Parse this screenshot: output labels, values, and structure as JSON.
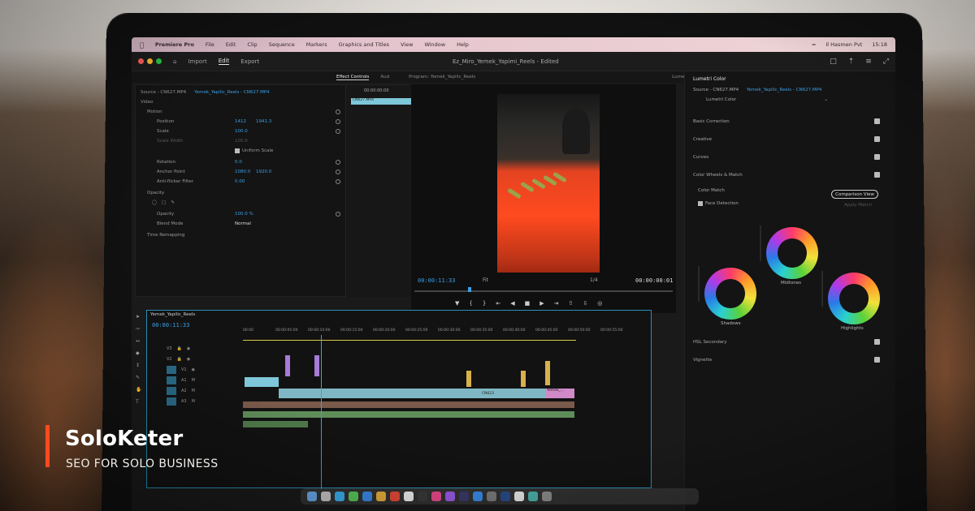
{
  "brand": {
    "name": "SoloKeter",
    "tagline": "SEO FOR SOLO BUSINESS",
    "accent_color": "#ff4a1f"
  },
  "menubar": {
    "app": "Premiere Pro",
    "items": [
      "File",
      "Edit",
      "Clip",
      "Sequence",
      "Markers",
      "Graphics and Titles",
      "View",
      "Window",
      "Help"
    ],
    "right_user": "Il Hasmen Pvt",
    "right_time": "15:18"
  },
  "app_header": {
    "tabs": [
      "Import",
      "Edit",
      "Export"
    ],
    "active_tab": "Edit",
    "document_title": "Ez_Miro_Yemek_Yapimi_Reels - Edited"
  },
  "panel_tabs": {
    "items": [
      "Effect Controls",
      "Aud"
    ],
    "program_label": "Program: Yemek_Yapilic_Reels",
    "lumetri_label": "Lumetri Color"
  },
  "effect_controls": {
    "source": "Source - CN627.MP4",
    "sequence": "Yemek_Yapilic_Reels - CN627.MP4",
    "video_label": "Video",
    "motion_label": "Motion",
    "rows": [
      {
        "label": "Position",
        "value": "1412",
        "value2": "1941.3"
      },
      {
        "label": "Scale",
        "value": "100.0"
      },
      {
        "label": "Scale Width",
        "value": "100.0"
      },
      {
        "label": "Uniform Scale",
        "value": ""
      },
      {
        "label": "Rotation",
        "value": "0.0"
      },
      {
        "label": "Anchor Point",
        "value": "1080.0",
        "value2": "1920.0"
      },
      {
        "label": "Anti-flicker Filter",
        "value": "0.00"
      }
    ],
    "opacity_label": "Opacity",
    "opacity_value": "100.0 %",
    "blend_label": "Blend Mode",
    "blend_value": "Normal",
    "time_remap_label": "Time Remapping",
    "clip_name": "CN627.MP4",
    "timecode_top": "00:00:00:00"
  },
  "program_monitor": {
    "timecode_current": "00:00:11:33",
    "fit": "Fit",
    "quality": "1/4",
    "timecode_duration": "00:00:00:01"
  },
  "timeline": {
    "sequence_name": "Yemek_Yapilic_Reels",
    "timecode": "00:00:11:33",
    "ruler": [
      "00:00",
      "00:00:05:00",
      "00:00:10:00",
      "00:00:15:00",
      "00:00:20:00",
      "00:00:25:00",
      "00:00:30:00",
      "00:00:35:00",
      "00:00:40:00",
      "00:00:45:00",
      "00:00:50:00",
      "00:00:55:00",
      "00:01:00:00"
    ],
    "video_tracks": [
      "V3",
      "V2",
      "V1"
    ],
    "audio_tracks": [
      "A1",
      "A2",
      "A3"
    ],
    "clip_labels": [
      "CN623",
      "Yemek_..."
    ]
  },
  "lumetri": {
    "title": "Lumetri Color",
    "source": "Source - CN627.MP4",
    "sequence": "Yemek_Yapilic_Reels - CN627.MP4",
    "preset": "Lumetri Color",
    "sections": [
      "Basic Correction",
      "Creative",
      "Curves",
      "Color Wheels & Match"
    ],
    "color_match": "Color Match",
    "comparison_view": "Comparison View",
    "face_detection": "Face Detection",
    "apply_match": "Apply Match",
    "wheels": [
      "Midtones",
      "Shadows",
      "Highlights"
    ],
    "hsl": "HSL Secondary",
    "vignette": "Vignette"
  },
  "colors": {
    "timeline_accent": "#3aa0e6",
    "clip_teal": "#7ec7d8",
    "audio_green": "#5f8d5a"
  }
}
